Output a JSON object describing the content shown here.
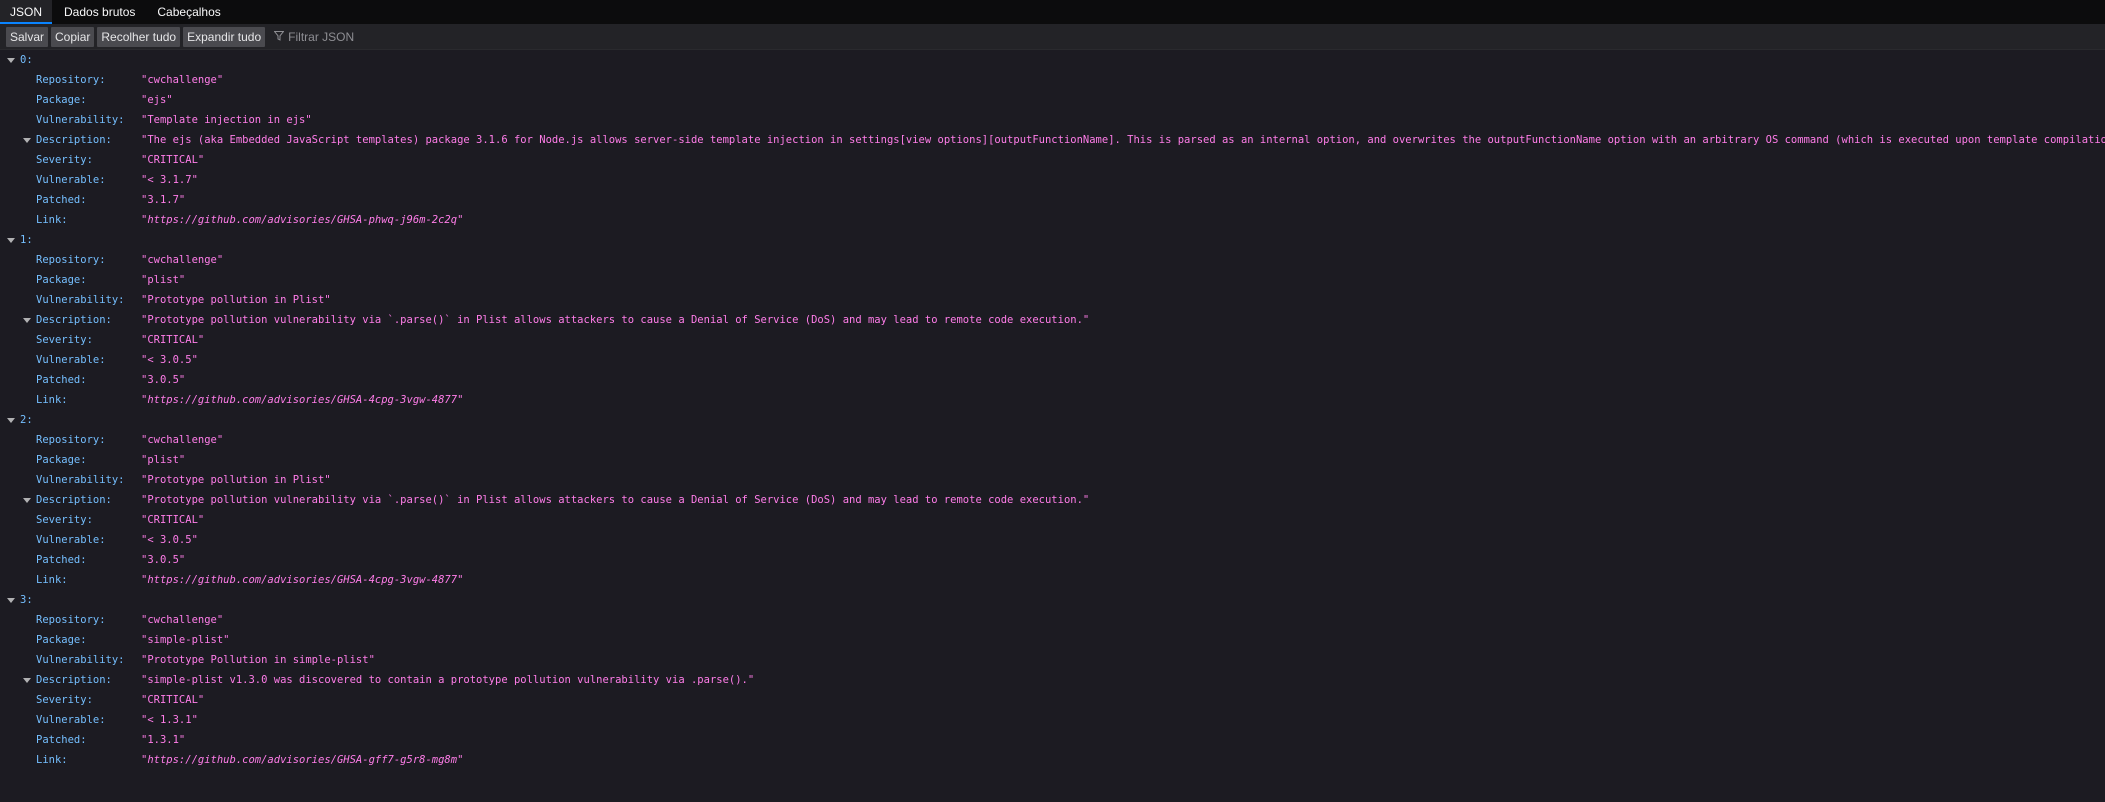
{
  "tabs": [
    {
      "label": "JSON",
      "active": true
    },
    {
      "label": "Dados brutos",
      "active": false
    },
    {
      "label": "Cabeçalhos",
      "active": false
    }
  ],
  "toolbar": {
    "save": "Salvar",
    "copy": "Copiar",
    "collapse_all": "Recolher tudo",
    "expand_all": "Expandir tudo",
    "filter_placeholder": "Filtrar JSON"
  },
  "keys": {
    "repository": "Repository:",
    "package": "Package:",
    "vulnerability": "Vulnerability:",
    "description": "Description:",
    "severity": "Severity:",
    "vulnerable": "Vulnerable:",
    "patched": "Patched:",
    "link": "Link:"
  },
  "entries": [
    {
      "index": "0:",
      "repository": "\"cwchallenge\"",
      "package": "\"ejs\"",
      "vulnerability": "\"Template injection in ejs\"",
      "description": "\"The ejs (aka Embedded JavaScript templates) package 3.1.6 for Node.js allows server-side template injection in settings[view options][outputFunctionName]. This is parsed as an internal option, and overwrites the outputFunctionName option with an arbitrary OS command (which is executed upon template compilation).\"",
      "severity": "\"CRITICAL\"",
      "vulnerable": "\"< 3.1.7\"",
      "patched": "\"3.1.7\"",
      "link": "\"https://github.com/advisories/GHSA-phwq-j96m-2c2q\""
    },
    {
      "index": "1:",
      "repository": "\"cwchallenge\"",
      "package": "\"plist\"",
      "vulnerability": "\"Prototype pollution in Plist\"",
      "description": "\"Prototype pollution vulnerability via `.parse()` in Plist allows attackers to cause a Denial of Service (DoS) and may lead to remote code execution.\"",
      "severity": "\"CRITICAL\"",
      "vulnerable": "\"< 3.0.5\"",
      "patched": "\"3.0.5\"",
      "link": "\"https://github.com/advisories/GHSA-4cpg-3vgw-4877\""
    },
    {
      "index": "2:",
      "repository": "\"cwchallenge\"",
      "package": "\"plist\"",
      "vulnerability": "\"Prototype pollution in Plist\"",
      "description": "\"Prototype pollution vulnerability via `.parse()` in Plist allows attackers to cause a Denial of Service (DoS) and may lead to remote code execution.\"",
      "severity": "\"CRITICAL\"",
      "vulnerable": "\"< 3.0.5\"",
      "patched": "\"3.0.5\"",
      "link": "\"https://github.com/advisories/GHSA-4cpg-3vgw-4877\""
    },
    {
      "index": "3:",
      "repository": "\"cwchallenge\"",
      "package": "\"simple-plist\"",
      "vulnerability": "\"Prototype Pollution in simple-plist\"",
      "description": "\"simple-plist v1.3.0 was discovered to contain a prototype pollution vulnerability via .parse().\"",
      "severity": "\"CRITICAL\"",
      "vulnerable": "\"< 1.3.1\"",
      "patched": "\"1.3.1\"",
      "link": "\"https://github.com/advisories/GHSA-gff7-g5r8-mg8m\""
    }
  ]
}
